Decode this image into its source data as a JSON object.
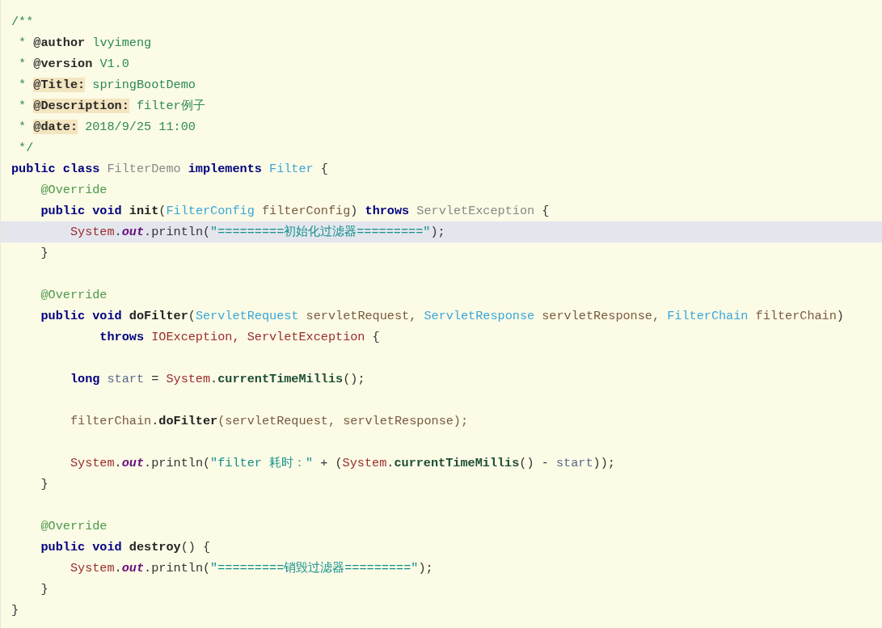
{
  "lines": [
    {
      "current": false,
      "tokens": [
        {
          "text": "/**",
          "kind": "comment"
        }
      ]
    },
    {
      "current": false,
      "tokens": [
        {
          "text": " * ",
          "kind": "comment"
        },
        {
          "text": "@author",
          "kind": "doctag"
        },
        {
          "text": " lvyimeng",
          "kind": "comment"
        }
      ]
    },
    {
      "current": false,
      "tokens": [
        {
          "text": " * ",
          "kind": "comment"
        },
        {
          "text": "@version",
          "kind": "doctag"
        },
        {
          "text": " V1.0",
          "kind": "comment"
        }
      ]
    },
    {
      "current": false,
      "tokens": [
        {
          "text": " * ",
          "kind": "comment"
        },
        {
          "text": "@Title:",
          "kind": "doctag-marked"
        },
        {
          "text": " springBootDemo",
          "kind": "comment"
        }
      ]
    },
    {
      "current": false,
      "tokens": [
        {
          "text": " * ",
          "kind": "comment"
        },
        {
          "text": "@Description:",
          "kind": "doctag-marked"
        },
        {
          "text": " filter例子",
          "kind": "comment"
        }
      ]
    },
    {
      "current": false,
      "tokens": [
        {
          "text": " * ",
          "kind": "comment"
        },
        {
          "text": "@date:",
          "kind": "doctag-marked"
        },
        {
          "text": " 2018/9/25 11:00",
          "kind": "comment"
        }
      ]
    },
    {
      "current": false,
      "tokens": [
        {
          "text": " */",
          "kind": "comment"
        }
      ]
    },
    {
      "current": false,
      "tokens": [
        {
          "text": "public class ",
          "kind": "keyword"
        },
        {
          "text": "FilterDemo ",
          "kind": "classname"
        },
        {
          "text": "implements ",
          "kind": "keyword"
        },
        {
          "text": "Filter ",
          "kind": "type"
        },
        {
          "text": "{",
          "kind": "plain"
        }
      ]
    },
    {
      "current": false,
      "tokens": [
        {
          "text": "    @Override",
          "kind": "annotation"
        }
      ]
    },
    {
      "current": false,
      "tokens": [
        {
          "text": "    public void ",
          "kind": "keyword"
        },
        {
          "text": "init",
          "kind": "method-decl"
        },
        {
          "text": "(",
          "kind": "plain"
        },
        {
          "text": "FilterConfig ",
          "kind": "type"
        },
        {
          "text": "filterConfig",
          "kind": "param"
        },
        {
          "text": ") ",
          "kind": "plain"
        },
        {
          "text": "throws ",
          "kind": "keyword"
        },
        {
          "text": "ServletException ",
          "kind": "classname"
        },
        {
          "text": "{",
          "kind": "plain"
        }
      ]
    },
    {
      "current": true,
      "tokens": [
        {
          "text": "        System",
          "kind": "class-ref"
        },
        {
          "text": ".",
          "kind": "plain"
        },
        {
          "text": "out",
          "kind": "static-field"
        },
        {
          "text": ".println(",
          "kind": "plain"
        },
        {
          "text": "\"=========初始化过滤器=========\"",
          "kind": "string"
        },
        {
          "text": ");",
          "kind": "plain"
        }
      ]
    },
    {
      "current": false,
      "tokens": [
        {
          "text": "    }",
          "kind": "plain"
        }
      ]
    },
    {
      "current": false
    },
    {
      "current": false,
      "tokens": [
        {
          "text": "    @Override",
          "kind": "annotation"
        }
      ]
    },
    {
      "current": false,
      "tokens": [
        {
          "text": "    public void ",
          "kind": "keyword"
        },
        {
          "text": "doFilter",
          "kind": "method-decl"
        },
        {
          "text": "(",
          "kind": "plain"
        },
        {
          "text": "ServletRequest ",
          "kind": "type"
        },
        {
          "text": "servletRequest, ",
          "kind": "param"
        },
        {
          "text": "ServletResponse ",
          "kind": "type"
        },
        {
          "text": "servletResponse, ",
          "kind": "param"
        },
        {
          "text": "FilterChain ",
          "kind": "type"
        },
        {
          "text": "filterChain",
          "kind": "param"
        },
        {
          "text": ")",
          "kind": "plain"
        }
      ]
    },
    {
      "current": false,
      "tokens": [
        {
          "text": "            throws ",
          "kind": "keyword"
        },
        {
          "text": "IOException, ServletException ",
          "kind": "class-ref"
        },
        {
          "text": "{",
          "kind": "plain"
        }
      ]
    },
    {
      "current": false
    },
    {
      "current": false,
      "tokens": [
        {
          "text": "        long ",
          "kind": "keyword"
        },
        {
          "text": "start ",
          "kind": "local"
        },
        {
          "text": "= ",
          "kind": "plain"
        },
        {
          "text": "System",
          "kind": "class-ref"
        },
        {
          "text": ".",
          "kind": "plain"
        },
        {
          "text": "currentTimeMillis",
          "kind": "static-call"
        },
        {
          "text": "();",
          "kind": "plain"
        }
      ]
    },
    {
      "current": false
    },
    {
      "current": false,
      "tokens": [
        {
          "text": "        filterChain",
          "kind": "param"
        },
        {
          "text": ".",
          "kind": "plain"
        },
        {
          "text": "doFilter",
          "kind": "method-decl"
        },
        {
          "text": "(servletRequest, servletResponse);",
          "kind": "param"
        }
      ]
    },
    {
      "current": false
    },
    {
      "current": false,
      "tokens": [
        {
          "text": "        System",
          "kind": "class-ref"
        },
        {
          "text": ".",
          "kind": "plain"
        },
        {
          "text": "out",
          "kind": "static-field"
        },
        {
          "text": ".println(",
          "kind": "plain"
        },
        {
          "text": "\"filter 耗时：\" ",
          "kind": "string"
        },
        {
          "text": "+ (",
          "kind": "plain"
        },
        {
          "text": "System",
          "kind": "class-ref"
        },
        {
          "text": ".",
          "kind": "plain"
        },
        {
          "text": "currentTimeMillis",
          "kind": "static-call"
        },
        {
          "text": "() - ",
          "kind": "plain"
        },
        {
          "text": "start",
          "kind": "local"
        },
        {
          "text": "));",
          "kind": "plain"
        }
      ]
    },
    {
      "current": false,
      "tokens": [
        {
          "text": "    }",
          "kind": "plain"
        }
      ]
    },
    {
      "current": false
    },
    {
      "current": false,
      "tokens": [
        {
          "text": "    @Override",
          "kind": "annotation"
        }
      ]
    },
    {
      "current": false,
      "tokens": [
        {
          "text": "    public void ",
          "kind": "keyword"
        },
        {
          "text": "destroy",
          "kind": "method-decl"
        },
        {
          "text": "() {",
          "kind": "plain"
        }
      ]
    },
    {
      "current": false,
      "tokens": [
        {
          "text": "        System",
          "kind": "class-ref"
        },
        {
          "text": ".",
          "kind": "plain"
        },
        {
          "text": "out",
          "kind": "static-field"
        },
        {
          "text": ".println(",
          "kind": "plain"
        },
        {
          "text": "\"=========销毁过滤器=========\"",
          "kind": "string"
        },
        {
          "text": ");",
          "kind": "plain"
        }
      ]
    },
    {
      "current": false,
      "tokens": [
        {
          "text": "    }",
          "kind": "plain"
        }
      ]
    },
    {
      "current": false,
      "tokens": [
        {
          "text": "}",
          "kind": "plain"
        }
      ]
    }
  ]
}
